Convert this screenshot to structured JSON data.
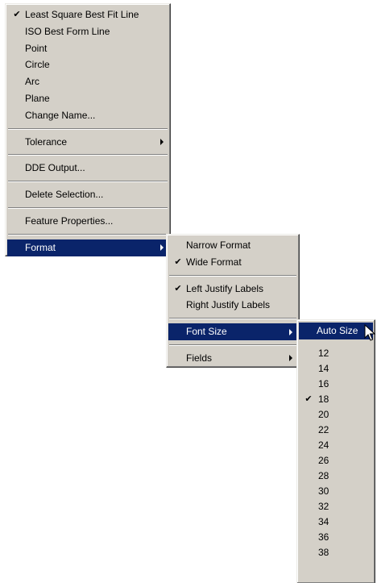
{
  "context_menu": {
    "items": [
      {
        "label": "Least Square Best Fit Line",
        "checked": true
      },
      {
        "label": "ISO Best Form Line"
      },
      {
        "label": "Point"
      },
      {
        "label": "Circle"
      },
      {
        "label": "Arc"
      },
      {
        "label": "Plane"
      },
      {
        "label": "Change Name..."
      },
      {
        "label": "Tolerance",
        "has_submenu": true
      },
      {
        "label": "DDE Output..."
      },
      {
        "label": "Delete Selection..."
      },
      {
        "label": "Feature Properties..."
      },
      {
        "label": "Format",
        "has_submenu": true,
        "selected": true
      }
    ]
  },
  "format_submenu": {
    "items": [
      {
        "label": "Narrow Format"
      },
      {
        "label": "Wide Format",
        "checked": true
      },
      {
        "label": "Left Justify Labels",
        "checked": true
      },
      {
        "label": "Right Justify Labels"
      },
      {
        "label": "Font Size",
        "has_submenu": true,
        "selected": true
      },
      {
        "label": "Fields",
        "has_submenu": true
      }
    ]
  },
  "font_size_submenu": {
    "auto_label": "Auto Size",
    "sizes": [
      "12",
      "14",
      "16",
      "18",
      "20",
      "22",
      "24",
      "26",
      "28",
      "30",
      "32",
      "34",
      "36",
      "38"
    ],
    "checked_size": "18"
  },
  "check_glyph": "✔",
  "colors": {
    "menu_background": "#d4d0c8",
    "selection_background": "#0a246a",
    "selection_text": "#ffffff"
  }
}
